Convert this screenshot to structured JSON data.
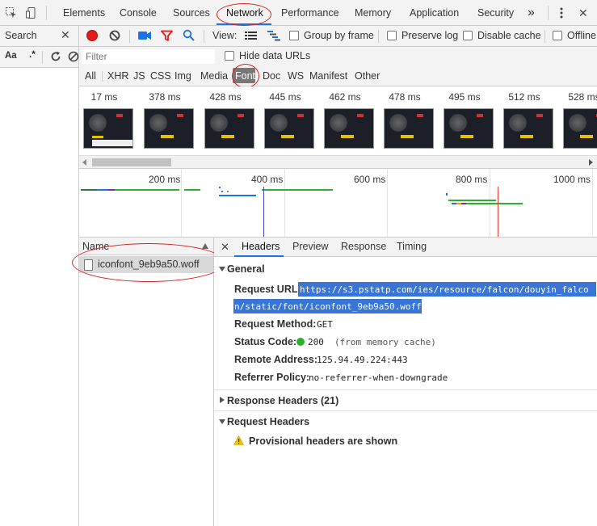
{
  "topbar": {
    "tabs": [
      "Elements",
      "Console",
      "Sources",
      "Network",
      "Performance",
      "Memory",
      "Application",
      "Security"
    ],
    "active_tab": "Network",
    "more": "»",
    "close": "✕"
  },
  "search_pane": {
    "title": "Search",
    "close": "✕",
    "match_case": "Aa",
    "regex": ".*"
  },
  "toolbar": {
    "view_label": "View:",
    "group_by_frame": "Group by frame",
    "preserve_log": "Preserve log",
    "disable_cache": "Disable cache",
    "offline": "Offline"
  },
  "filter": {
    "placeholder": "Filter",
    "hide_data_urls": "Hide data URLs"
  },
  "types": {
    "items": [
      "All",
      "XHR",
      "JS",
      "CSS",
      "Img",
      "Media",
      "Font",
      "Doc",
      "WS",
      "Manifest",
      "Other"
    ],
    "active": "Font"
  },
  "filmstrip": {
    "times": [
      "17 ms",
      "378 ms",
      "428 ms",
      "445 ms",
      "462 ms",
      "478 ms",
      "495 ms",
      "512 ms",
      "528 ms"
    ]
  },
  "overview": {
    "ticks": [
      "200 ms",
      "400 ms",
      "600 ms",
      "800 ms",
      "1000 ms"
    ]
  },
  "requests": {
    "column": "Name",
    "items": [
      "iconfont_9eb9a50.woff"
    ]
  },
  "details": {
    "close": "✕",
    "tabs": [
      "Headers",
      "Preview",
      "Response",
      "Timing"
    ],
    "active_tab": "Headers",
    "general_title": "General",
    "general": {
      "request_url_key": "Request URL:",
      "request_url_line1": "https://s3.pstatp.com/ies/resource/falcon/douyin_falco",
      "request_url_line2": "n/static/font/iconfont_9eb9a50.woff",
      "request_method_key": "Request Method:",
      "request_method": "GET",
      "status_code_key": "Status Code:",
      "status_code": "200",
      "status_note": "(from memory cache)",
      "remote_address_key": "Remote Address:",
      "remote_address": "125.94.49.224:443",
      "referrer_policy_key": "Referrer Policy:",
      "referrer_policy": "no-referrer-when-downgrade"
    },
    "response_headers_title": "Response Headers (21)",
    "request_headers_title": "Request Headers",
    "provisional_warning": "Provisional headers are shown"
  },
  "colors": {
    "annotation": "#dd2222",
    "record": "#e21b1b",
    "accent": "#1a73e8",
    "status_ok": "#2fb12f",
    "url_highlight": "#3875d7"
  }
}
